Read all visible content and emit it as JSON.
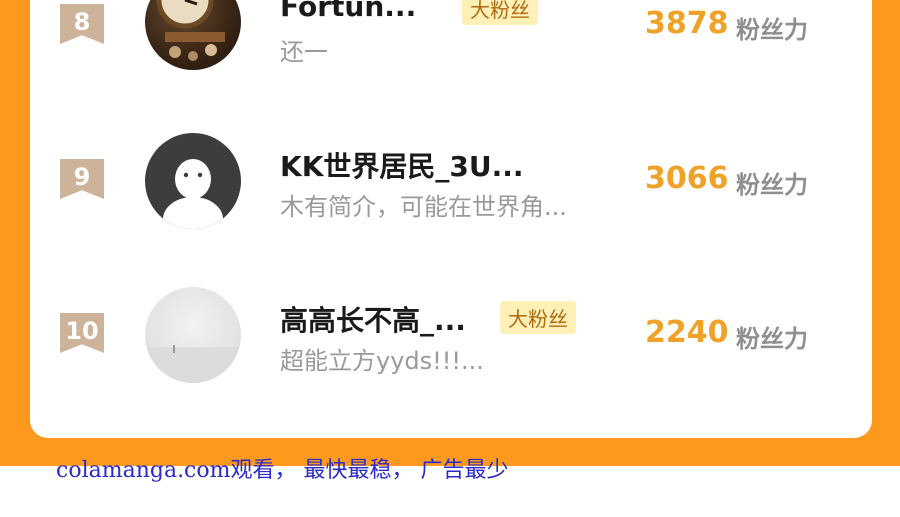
{
  "rows": [
    {
      "rank": "8",
      "name": "Fortun...",
      "badge": "大粉丝",
      "bio": "还一",
      "score": "3878",
      "unit": "粉丝力",
      "avatar": "clock-photo-avatar"
    },
    {
      "rank": "9",
      "name": "KK世界居民_3U...",
      "badge": "",
      "bio": "木有简介，可能在世界角...",
      "score": "3066",
      "unit": "粉丝力",
      "avatar": "default-avatar"
    },
    {
      "rank": "10",
      "name": "高高长不高_...",
      "badge": "大粉丝",
      "bio": "超能立方yyds!!!...",
      "score": "2240",
      "unit": "粉丝力",
      "avatar": "foggy-photo-avatar"
    }
  ],
  "watermark": "colamanga.com观看， 最快最稳， 广告最少",
  "colors": {
    "frame": "#fd9a1e",
    "score": "#f0a228",
    "badge_bg": "#fff0b8",
    "rank_ribbon": "#ceb39b",
    "watermark": "#2b2bc9"
  }
}
